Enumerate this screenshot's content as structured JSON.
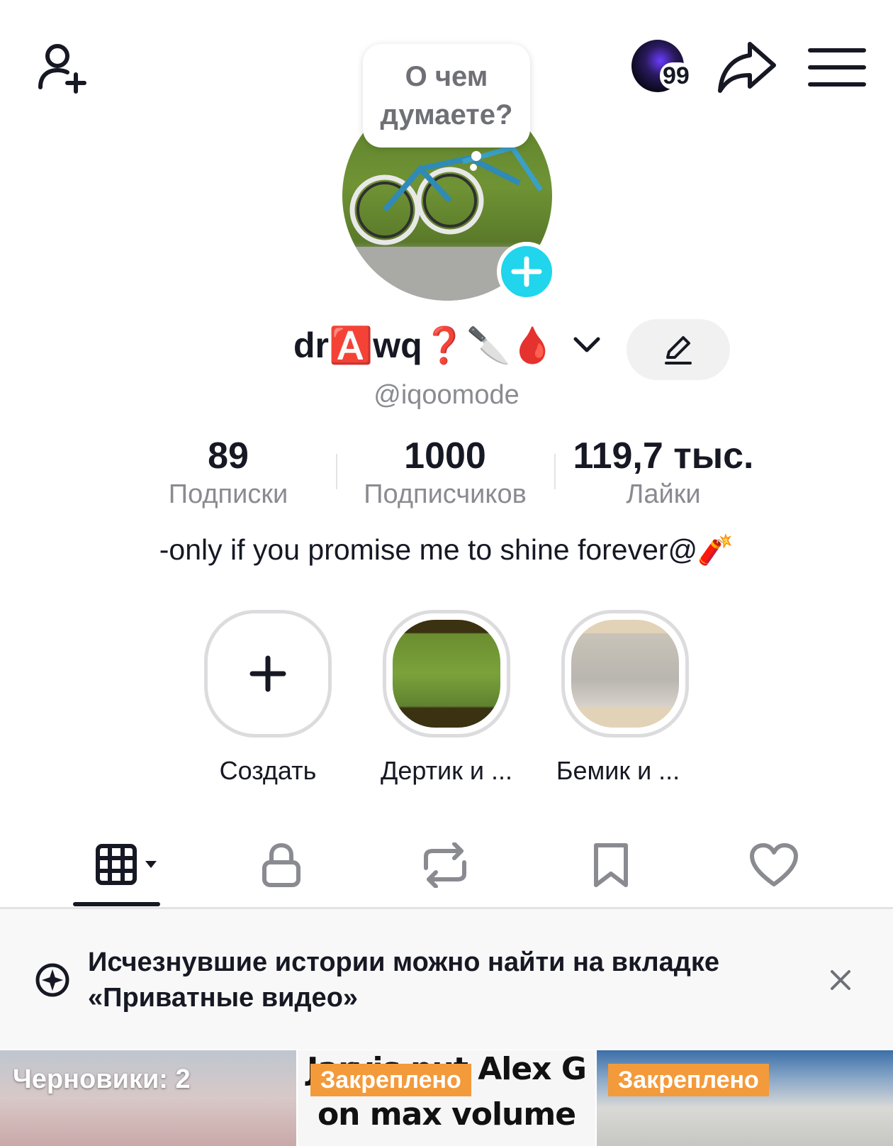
{
  "header": {
    "add_friend_icon": "person-plus-icon",
    "notifications_badge": "99",
    "share_icon": "share-arrow-icon",
    "menu_icon": "hamburger-menu-icon"
  },
  "bubble": {
    "text": "О чем думаете?"
  },
  "profile": {
    "display_name": "dr🅰️wq❓🔪🩸",
    "handle": "@iqoomode",
    "bio": "-only if you promise me to shine forever@🧨"
  },
  "stats": [
    {
      "value": "89",
      "label": "Подписки"
    },
    {
      "value": "1000",
      "label": "Подписчиков"
    },
    {
      "value": "119,7 тыс.",
      "label": "Лайки"
    }
  ],
  "highlights": [
    {
      "label": "Создать"
    },
    {
      "label": "Дертик и ..."
    },
    {
      "label": "Бемик и ..."
    }
  ],
  "tabs": [
    "videos-grid-icon",
    "lock-icon",
    "repost-icon",
    "bookmark-icon",
    "heart-icon"
  ],
  "banner": {
    "text": "Исчезнувшие истории можно найти на вкладке «Приватные видео»"
  },
  "grid": {
    "drafts_label": "Черновики: 2",
    "pinned_label": "Закреплено",
    "tile2_caption": "Jarvis put Alex G on max volume"
  },
  "colors": {
    "accent": "#20d5ec",
    "pinned": "#f39a3b"
  }
}
